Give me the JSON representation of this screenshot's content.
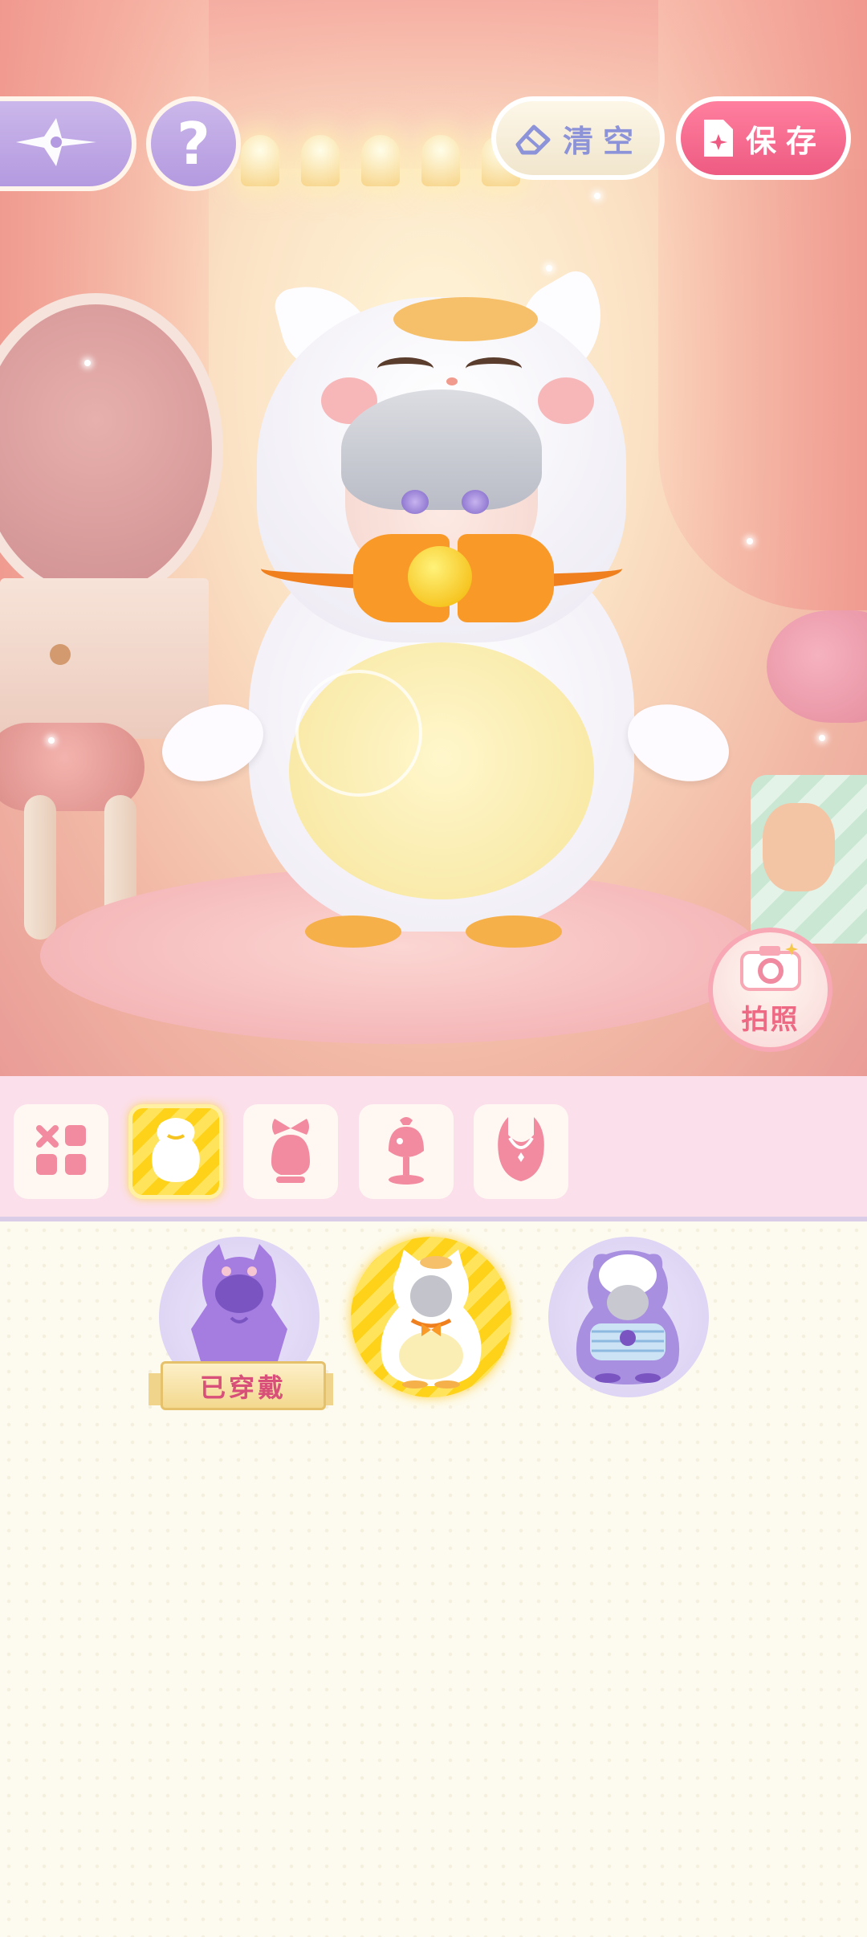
{
  "hud": {
    "clear_label": "清空",
    "save_label": "保存",
    "photo_label": "拍照",
    "help_label": "?"
  },
  "tabs": [
    {
      "icon": "grid-icon",
      "active": false
    },
    {
      "icon": "costume-icon",
      "active": true
    },
    {
      "icon": "hair-bow-icon",
      "active": false
    },
    {
      "icon": "hat-icon",
      "active": false
    },
    {
      "icon": "necklace-icon",
      "active": false
    }
  ],
  "items": [
    {
      "icon": "purple-cat-hoodie-icon",
      "badge": "已穿戴",
      "selected": false
    },
    {
      "icon": "white-cat-costume-icon",
      "badge": "",
      "selected": true
    },
    {
      "icon": "hamster-costume-icon",
      "badge": "",
      "selected": false
    }
  ],
  "colors": {
    "accent_pink": "#ee5b82",
    "accent_yellow": "#ffd21a",
    "tabbar_bg": "#fbdfea",
    "panel_bg": "#fdfbef",
    "hud_purple": "#b49ae0"
  }
}
